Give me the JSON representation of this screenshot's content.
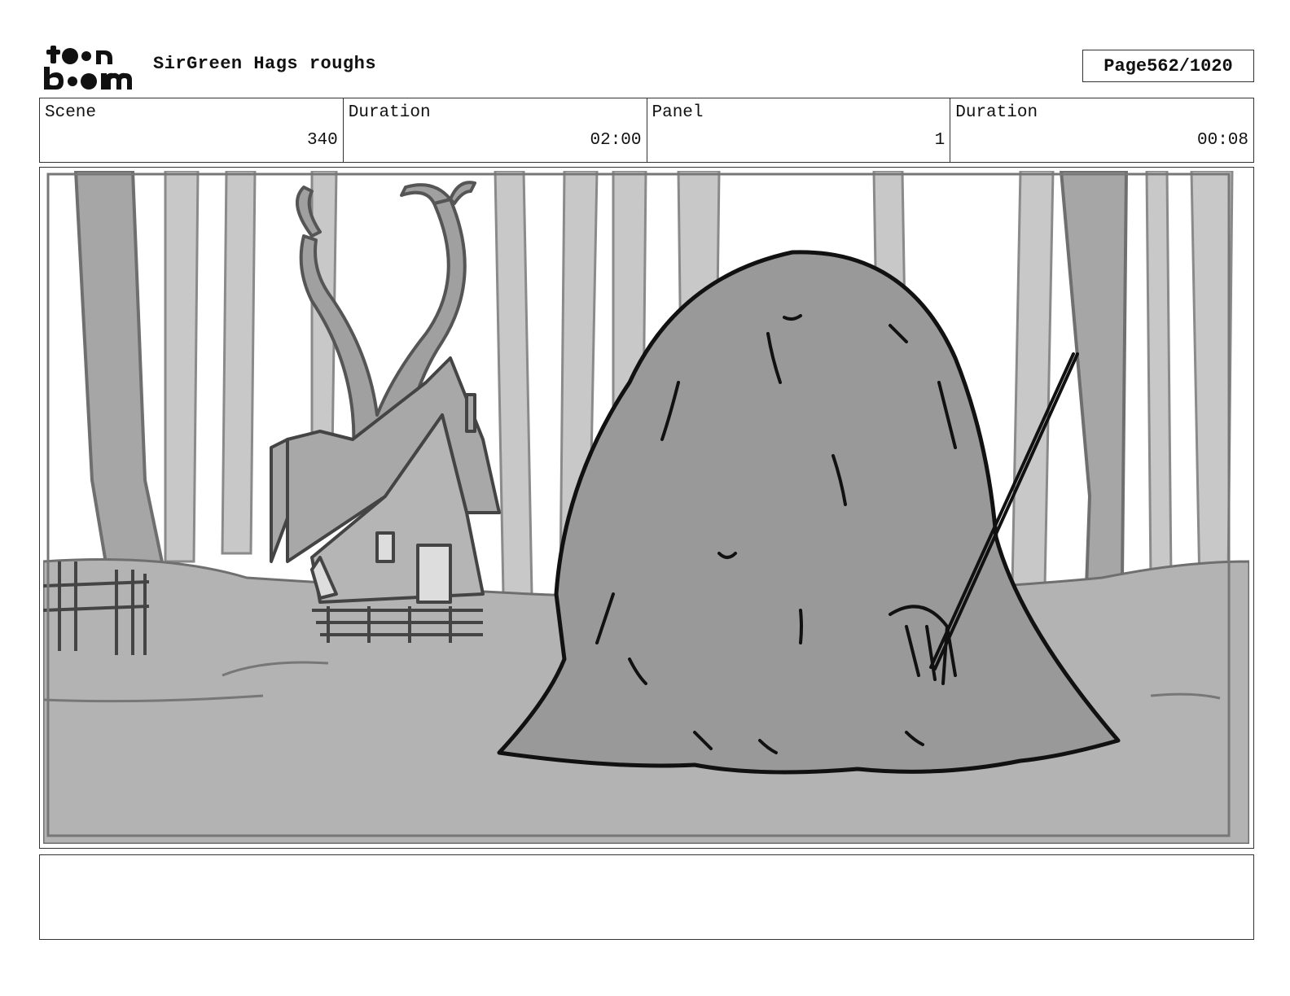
{
  "header": {
    "logo_text": "toon boom",
    "title": "SirGreen Hags roughs",
    "page_label": "Page",
    "page_number": "562/1020"
  },
  "info": {
    "scene_label": "Scene",
    "scene_value": "340",
    "scene_duration_label": "Duration",
    "scene_duration_value": "02:00",
    "panel_label": "Panel",
    "panel_value": "1",
    "panel_duration_label": "Duration",
    "panel_duration_value": "00:08"
  },
  "panel": {
    "image_content": "storyboard-sketch-haystack-cottage-forest"
  },
  "notes": {
    "text": ""
  },
  "colors": {
    "border": "#333333",
    "sketch_dark": "#111111",
    "tree_light": "#c8c8c8",
    "ground": "#b3b3b3",
    "haystack": "#999999"
  }
}
